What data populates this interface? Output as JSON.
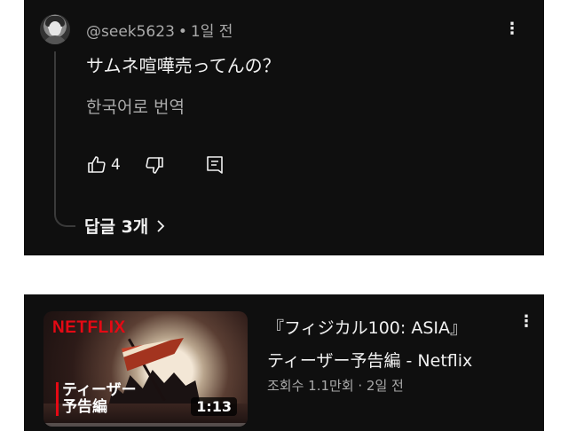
{
  "comment": {
    "author": "@seek5623",
    "separator": "•",
    "time": "1일 전",
    "text": "サムネ喧嘩売ってんの？",
    "translate_label": "한국어로 번역",
    "like_count": "4",
    "replies_label": "답글 3개",
    "icons": [
      "avatar",
      "more-vert-icon",
      "thumb-up-icon",
      "thumb-down-icon",
      "reply-icon",
      "chevron-right-icon"
    ]
  },
  "video": {
    "brand": "NETFLIX",
    "thumb_label_line1": "ティーザー",
    "thumb_label_line2": "予告編",
    "duration": "1:13",
    "title_line1": "『フィジカル100: ASIA』",
    "title_line2": "ティーザー予告編 - Netflix",
    "subtitle": "조회수 1.1만회 · 2일 전",
    "progress_fraction": 0.0,
    "icons": [
      "more-vert-icon"
    ]
  },
  "colors": {
    "background": "#0f0f0f",
    "text": "#f1f1f1",
    "secondary_text": "#aaaaaa",
    "netflix_red": "#e50914"
  }
}
